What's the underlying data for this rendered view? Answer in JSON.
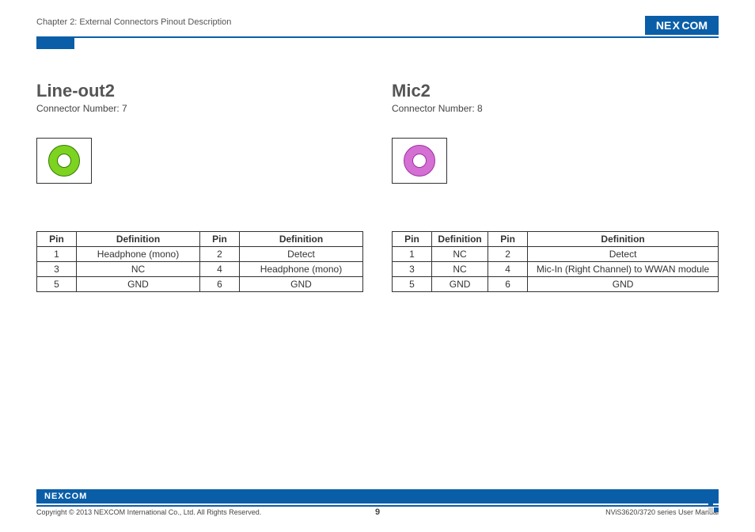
{
  "header": {
    "chapter": "Chapter 2: External Connectors Pinout Description",
    "brand_ne": "NE",
    "brand_x": "X",
    "brand_com": "COM"
  },
  "left": {
    "title": "Line-out2",
    "subtitle": "Connector Number: 7",
    "jack_color": "green",
    "table": {
      "headers": [
        "Pin",
        "Definition",
        "Pin",
        "Definition"
      ],
      "rows": [
        [
          "1",
          "Headphone (mono)",
          "2",
          "Detect"
        ],
        [
          "3",
          "NC",
          "4",
          "Headphone (mono)"
        ],
        [
          "5",
          "GND",
          "6",
          "GND"
        ]
      ]
    }
  },
  "right": {
    "title": "Mic2",
    "subtitle": "Connector Number: 8",
    "jack_color": "pink",
    "table": {
      "headers": [
        "Pin",
        "Definition",
        "Pin",
        "Definition"
      ],
      "rows": [
        [
          "1",
          "NC",
          "2",
          "Detect"
        ],
        [
          "3",
          "NC",
          "4",
          "Mic-In (Right Channel) to WWAN module"
        ],
        [
          "5",
          "GND",
          "6",
          "GND"
        ]
      ]
    }
  },
  "footer": {
    "copyright": "Copyright © 2013 NEXCOM International Co., Ltd. All Rights Reserved.",
    "page": "9",
    "manual": "NViS3620/3720 series User Manual"
  }
}
